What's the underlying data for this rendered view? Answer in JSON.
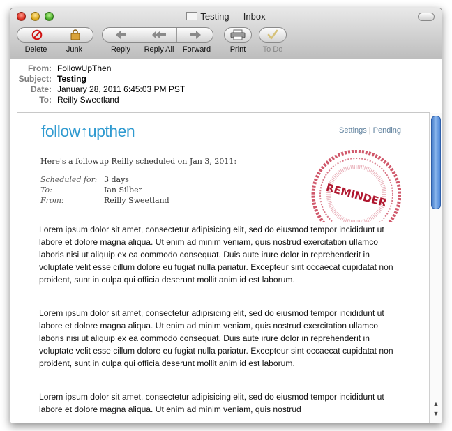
{
  "window": {
    "title": "Testing — Inbox"
  },
  "toolbar": {
    "delete": "Delete",
    "junk": "Junk",
    "reply": "Reply",
    "reply_all": "Reply All",
    "forward": "Forward",
    "print": "Print",
    "todo": "To Do"
  },
  "headers": {
    "from_label": "From:",
    "from": "FollowUpThen",
    "subject_label": "Subject:",
    "subject": "Testing",
    "date_label": "Date:",
    "date": "January 28, 2011 6:45:03 PM PST",
    "to_label": "To:",
    "to": "Reilly Sweetland"
  },
  "email": {
    "logo_prefix": "follow",
    "logo_suffix": "upthen",
    "link_settings": "Settings",
    "link_divider": "|",
    "link_pending": "Pending",
    "intro": "Here's a followup Reilly scheduled on Jan 3, 2011:",
    "meta": [
      {
        "label": "Scheduled for:",
        "value": "3 days"
      },
      {
        "label": "To:",
        "value": "Ian Silber"
      },
      {
        "label": "From:",
        "value": "Reilly Sweetland"
      }
    ],
    "stamp_text": "REMINDER",
    "paragraphs": [
      "Lorem ipsum dolor sit amet, consectetur adipisicing elit, sed do eiusmod tempor incididunt ut labore et dolore magna aliqua. Ut enim ad minim veniam, quis nostrud exercitation ullamco laboris nisi ut aliquip ex ea commodo consequat. Duis aute irure dolor in reprehenderit in voluptate velit esse cillum dolore eu fugiat nulla pariatur. Excepteur sint occaecat cupidatat non proident, sunt in culpa qui officia deserunt mollit anim id est laborum.",
      "Lorem ipsum dolor sit amet, consectetur adipisicing elit, sed do eiusmod tempor incididunt ut labore et dolore magna aliqua. Ut enim ad minim veniam, quis nostrud exercitation ullamco laboris nisi ut aliquip ex ea commodo consequat. Duis aute irure dolor in reprehenderit in voluptate velit esse cillum dolore eu fugiat nulla pariatur. Excepteur sint occaecat cupidatat non proident, sunt in culpa qui officia deserunt mollit anim id est laborum.",
      "Lorem ipsum dolor sit amet, consectetur adipisicing elit, sed do eiusmod tempor incididunt ut labore et dolore magna aliqua. Ut enim ad minim veniam, quis nostrud"
    ]
  },
  "colors": {
    "brand": "#2f9ad0",
    "stamp": "#c0203a",
    "scroll_thumb": "#4c86d8"
  }
}
